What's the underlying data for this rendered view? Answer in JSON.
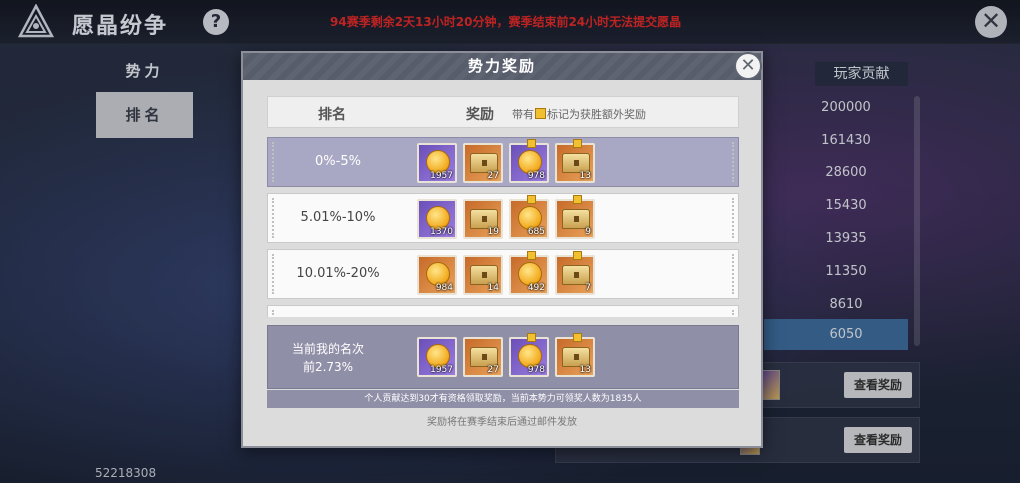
{
  "app": {
    "title": "愿晶纷争",
    "help": "?",
    "close": "✕"
  },
  "season_notice": "94赛季剩余2天13小时20分钟，赛季结束前24小时无法提交愿晶",
  "left_nav": {
    "items": [
      {
        "label": "势力"
      },
      {
        "label": "排名"
      }
    ]
  },
  "player_id": "52218308",
  "right_panel": {
    "header": "玩家贡献",
    "values": [
      "200000",
      "161430",
      "28600",
      "15430",
      "13935",
      "11350",
      "8610",
      "6050"
    ],
    "view_button": "查看奖励"
  },
  "modal": {
    "title": "势力奖励",
    "close": "✕",
    "table_head": {
      "rank": "排名",
      "reward": "奖励",
      "note_prefix": "带有",
      "note_suffix": "标记为获胜额外奖励"
    },
    "tiers": [
      {
        "label": "0%-5%",
        "items": [
          {
            "type": "coin",
            "color": "purple",
            "qty": "1957",
            "extra": false
          },
          {
            "type": "chest",
            "color": "orange",
            "qty": "27",
            "extra": false
          },
          {
            "type": "coin",
            "color": "purple",
            "qty": "978",
            "extra": true
          },
          {
            "type": "chest",
            "color": "orange",
            "qty": "13",
            "extra": true
          }
        ]
      },
      {
        "label": "5.01%-10%",
        "items": [
          {
            "type": "coin",
            "color": "purple",
            "qty": "1370",
            "extra": false
          },
          {
            "type": "chest",
            "color": "orange",
            "qty": "19",
            "extra": false
          },
          {
            "type": "coin",
            "color": "orange",
            "qty": "685",
            "extra": true
          },
          {
            "type": "chest",
            "color": "orange",
            "qty": "9",
            "extra": true
          }
        ]
      },
      {
        "label": "10.01%-20%",
        "items": [
          {
            "type": "coin",
            "color": "orange",
            "qty": "984",
            "extra": false
          },
          {
            "type": "chest",
            "color": "orange",
            "qty": "14",
            "extra": false
          },
          {
            "type": "coin",
            "color": "orange",
            "qty": "492",
            "extra": true
          },
          {
            "type": "chest",
            "color": "orange",
            "qty": "7",
            "extra": true
          }
        ]
      }
    ],
    "my_rank": {
      "line1": "当前我的名次",
      "line2": "前2.73%",
      "items": [
        {
          "type": "coin",
          "color": "purple",
          "qty": "1957",
          "extra": false
        },
        {
          "type": "chest",
          "color": "orange",
          "qty": "27",
          "extra": false
        },
        {
          "type": "coin",
          "color": "purple",
          "qty": "978",
          "extra": true
        },
        {
          "type": "chest",
          "color": "orange",
          "qty": "13",
          "extra": true
        }
      ]
    },
    "my_note": "个人贡献达到30才有资格领取奖励，当前本势力可领奖人数为1835人",
    "mail_note": "奖励将在赛季结束后通过邮件发放"
  }
}
